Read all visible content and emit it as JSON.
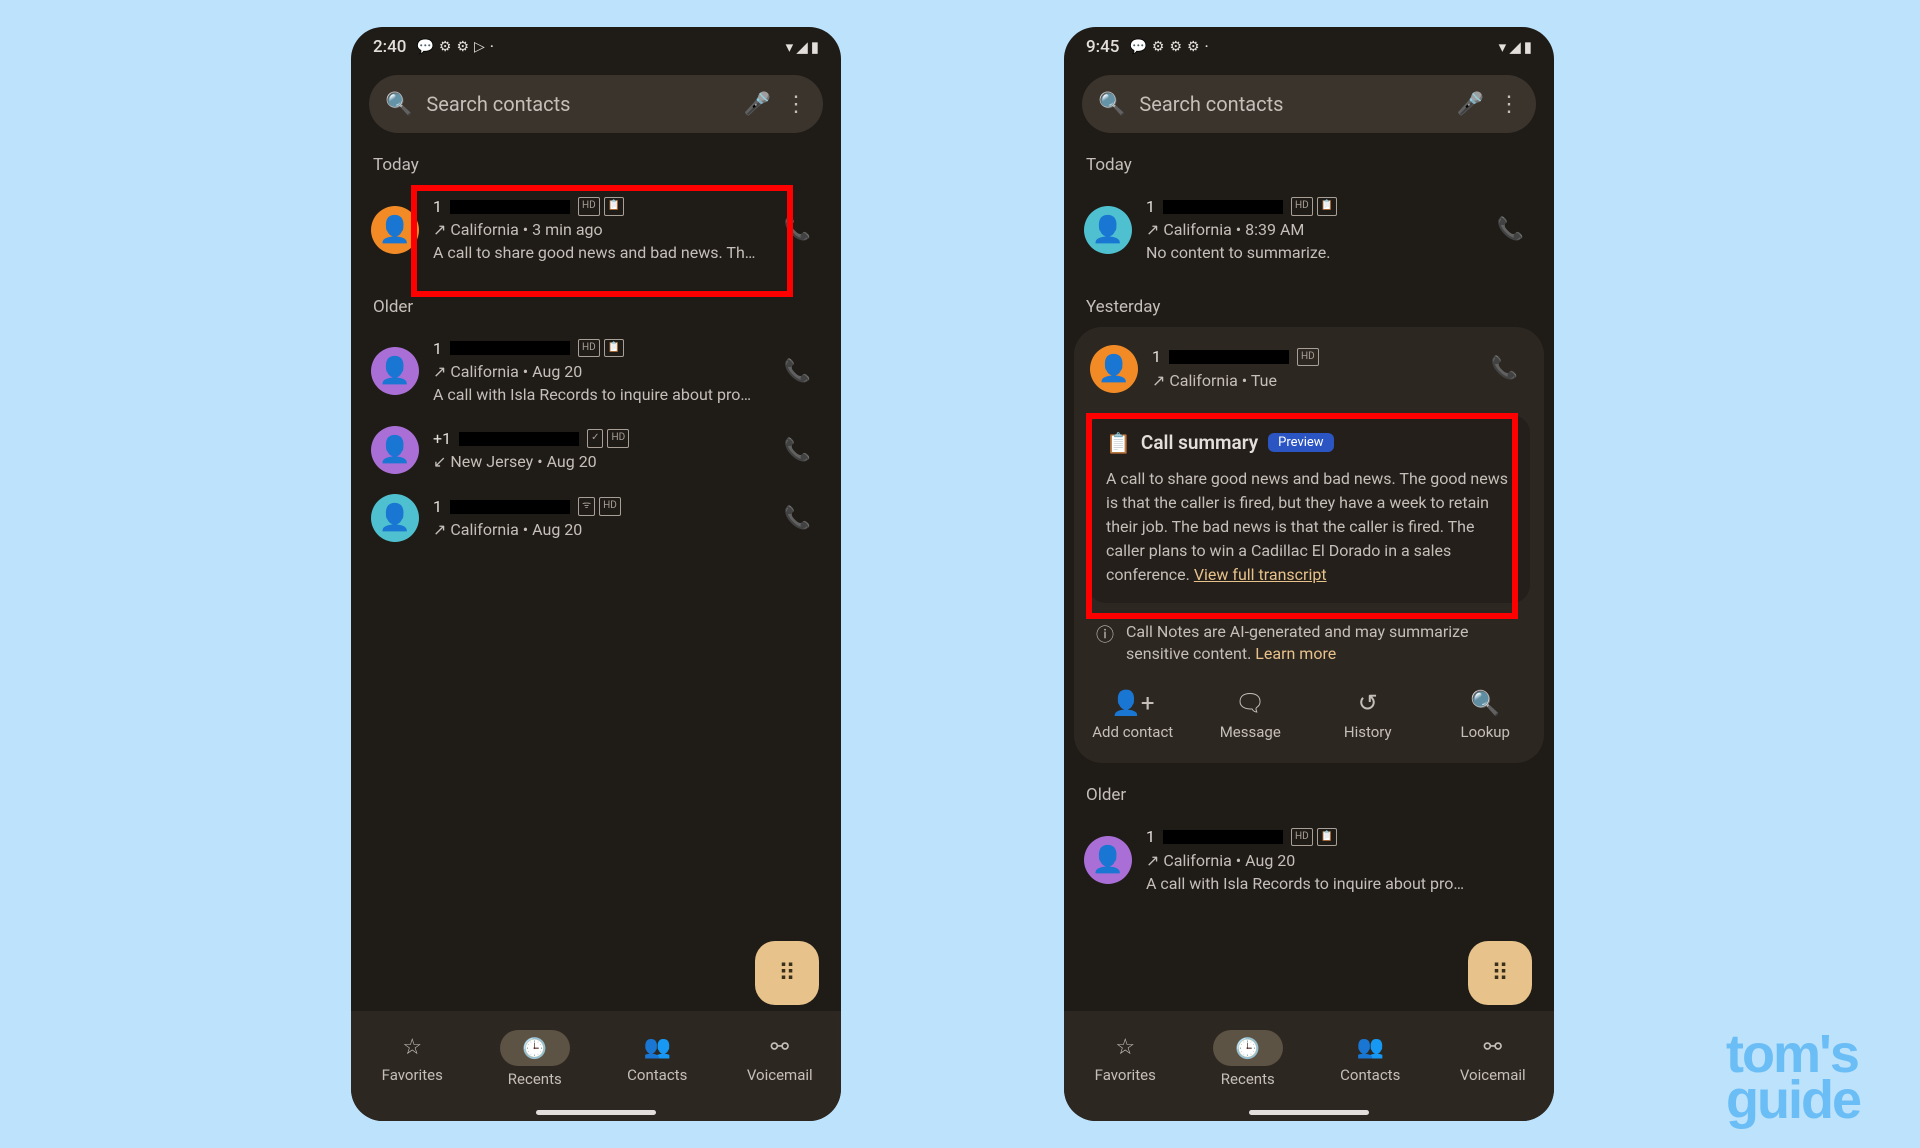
{
  "watermark": {
    "line1": "tom's",
    "line2": "guide"
  },
  "screens": {
    "left": {
      "status": {
        "time": "2:40",
        "icons_left": [
          "💬",
          "⚙",
          "⚙",
          "▷",
          "·"
        ],
        "icons_right": [
          "▾",
          "◢",
          "▮"
        ]
      },
      "search": {
        "placeholder": "Search contacts"
      },
      "sections": [
        {
          "label": "Today",
          "calls": [
            {
              "avatar": "orange",
              "number_prefix": "1",
              "redacted": true,
              "badges": [
                "HD",
                "📋"
              ],
              "direction": "out",
              "location": "California",
              "time": "3 min ago",
              "summary": "A call to share good news and bad news. Th…",
              "highlight": true
            }
          ]
        },
        {
          "label": "Older",
          "calls": [
            {
              "avatar": "purple",
              "number_prefix": "1",
              "redacted": true,
              "badges": [
                "HD",
                "📋"
              ],
              "direction": "out",
              "location": "California",
              "time": "Aug 20",
              "summary": "A call with Isla Records to inquire about pro…"
            },
            {
              "avatar": "purple",
              "number_prefix": "+1",
              "redacted": true,
              "badges": [
                "✓",
                "HD"
              ],
              "direction": "in",
              "location": "New Jersey",
              "time": "Aug 20"
            },
            {
              "avatar": "teal",
              "number_prefix": "1",
              "redacted": true,
              "badges": [
                "ᯤ",
                "HD"
              ],
              "direction": "out",
              "location": "California",
              "time": "Aug 20"
            }
          ]
        }
      ]
    },
    "right": {
      "status": {
        "time": "9:45",
        "icons_left": [
          "💬",
          "⚙",
          "⚙",
          "⚙",
          "·"
        ],
        "icons_right": [
          "▾",
          "◢",
          "▮"
        ]
      },
      "search": {
        "placeholder": "Search contacts"
      },
      "sections": [
        {
          "label": "Today",
          "calls": [
            {
              "avatar": "teal",
              "number_prefix": "1",
              "redacted": true,
              "badges": [
                "HD",
                "📋"
              ],
              "direction": "out",
              "location": "California",
              "time": "8:39 AM",
              "summary": "No content to summarize."
            }
          ]
        },
        {
          "label": "Yesterday",
          "expanded": {
            "call": {
              "avatar": "orange",
              "number_prefix": "1",
              "redacted": true,
              "badges": [
                "HD"
              ],
              "direction": "out",
              "location": "California",
              "time": "Tue"
            },
            "summary_title": "Call summary",
            "preview_label": "Preview",
            "summary_body": "A call to share good news and bad news. The good news is that the caller is fired, but they have a week to retain their job. The bad news is that the caller is fired. The caller plans to win a Cadillac El Dorado in a sales conference. ",
            "transcript_link": "View full transcript",
            "ai_note": "Call Notes are AI-generated and may summarize sensitive content. ",
            "learn_more": "Learn more",
            "actions": [
              {
                "icon": "👤+",
                "label": "Add contact"
              },
              {
                "icon": "🗨",
                "label": "Message"
              },
              {
                "icon": "↺",
                "label": "History"
              },
              {
                "icon": "🔍",
                "label": "Lookup"
              }
            ]
          }
        },
        {
          "label": "Older",
          "calls": [
            {
              "avatar": "purple",
              "number_prefix": "1",
              "redacted": true,
              "badges": [
                "HD",
                "📋"
              ],
              "direction": "out",
              "location": "California",
              "time": "Aug 20",
              "summary": "A call with Isla Records to inquire about pro…"
            }
          ]
        }
      ]
    }
  },
  "bottom_nav": [
    {
      "icon": "☆",
      "label": "Favorites"
    },
    {
      "icon": "🕒",
      "label": "Recents",
      "active": true
    },
    {
      "icon": "👥",
      "label": "Contacts"
    },
    {
      "icon": "⚯",
      "label": "Voicemail"
    }
  ],
  "meta_sep": " • "
}
